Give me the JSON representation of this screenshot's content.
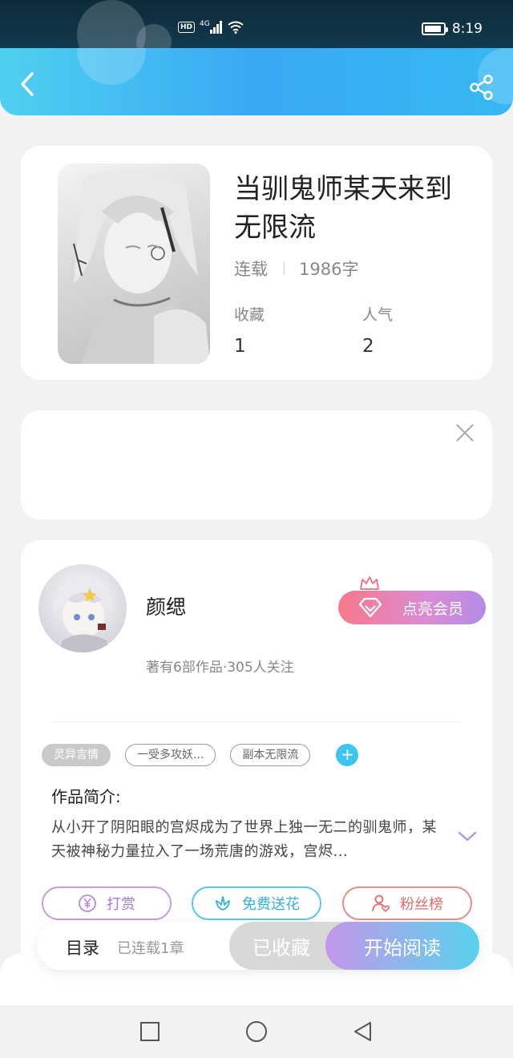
{
  "status_bar": {
    "hd": "HD",
    "signal": "4G",
    "time": "8:19",
    "battery_level": 0.9
  },
  "header": {
    "back_icon": "chevron-left-icon",
    "share_icon": "share-icon",
    "accent_start": "#4fd0f0",
    "accent_end": "#36b8f2"
  },
  "book": {
    "title": "当驯鬼师某天来到无限流",
    "status": "连载",
    "word_count": "1986字",
    "stats": [
      {
        "label": "收藏",
        "value": "1"
      },
      {
        "label": "人气",
        "value": "2"
      }
    ]
  },
  "ad": {
    "close_icon": "close-icon"
  },
  "author": {
    "name": "颜缌",
    "summary": "著有6部作品·305人关注",
    "vip_label": "点亮会员",
    "tags": [
      "灵异言情",
      "一受多攻妖...",
      "副本无限流"
    ],
    "add_tag_label": "+",
    "intro_label": "作品简介:",
    "intro_text": "从小开了阴阳眼的宫烬成为了世界上独一无二的驯鬼师，某天被神秘力量拉入了一场荒唐的游戏，宫烬...",
    "actions": [
      {
        "label": "打赏",
        "icon": "yen-coin-icon"
      },
      {
        "label": "免费送花",
        "icon": "flower-icon"
      },
      {
        "label": "粉丝榜",
        "icon": "user-heart-icon"
      }
    ]
  },
  "bottom_bar": {
    "toc_label": "目录",
    "toc_count": "已连载1章",
    "collected_label": "已收藏",
    "read_label": "开始阅读"
  }
}
